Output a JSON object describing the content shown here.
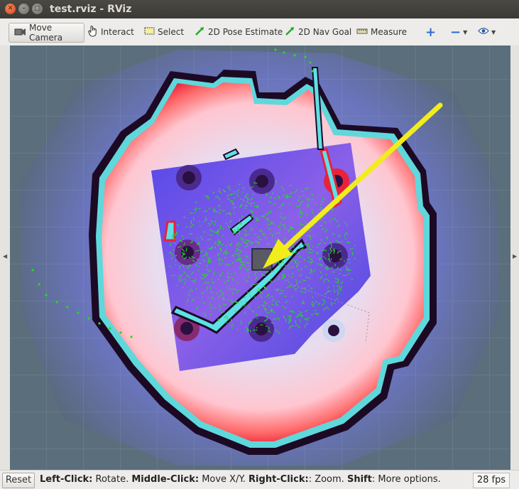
{
  "window": {
    "title": "test.rviz - RViz"
  },
  "toolbar": {
    "tools": [
      {
        "label": "Move Camera",
        "icon": "move-camera-icon",
        "active": true
      },
      {
        "label": "Interact",
        "icon": "hand-pointer-icon"
      },
      {
        "label": "Select",
        "icon": "select-box-icon"
      },
      {
        "label": "2D Pose Estimate",
        "icon": "green-arrow-icon"
      },
      {
        "label": "2D Nav Goal",
        "icon": "green-arrow-icon"
      },
      {
        "label": "Measure",
        "icon": "ruler-icon"
      }
    ],
    "add_icon": "plus-icon",
    "remove_icon": "minus-icon",
    "view_icon": "eye-icon"
  },
  "status": {
    "reset_label": "Reset",
    "hint": {
      "left_click_key": "Left-Click:",
      "left_click_action": "Rotate.",
      "middle_click_key": "Middle-Click:",
      "middle_click_action": "Move X/Y.",
      "right_click_key": "Right-Click:",
      "right_click_action": ": Zoom.",
      "shift_key": "Shift",
      "shift_action": ": More options."
    },
    "fps": "28 fps"
  },
  "colors": {
    "map_background": "#52657a",
    "costmap_inflation": "#ffffff",
    "lethal": "#c23b5a",
    "obstacle_cyan": "#66e0e0",
    "laser_green": "#22dd22",
    "nav_goal_arrow": "#f2ec1b"
  }
}
